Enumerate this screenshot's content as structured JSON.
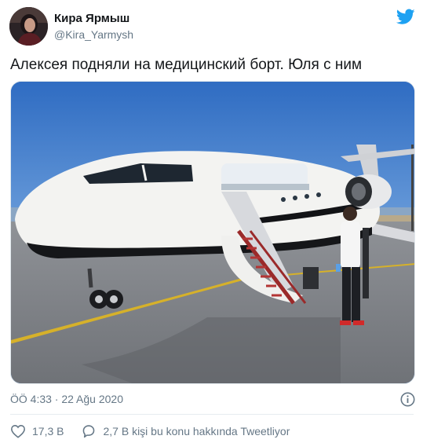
{
  "author": {
    "name": "Кира Ярмыш",
    "handle": "@Kira_Yarmysh"
  },
  "tweet": {
    "text": "Алексея подняли на медицинский борт. Юля с ним",
    "timestamp": "ÖÖ 4:33 · 22 Ağu 2020"
  },
  "actions": {
    "likes_count": "17,3 B",
    "conversation_label": "2,7 B kişi bu konu hakkında Tweetliyor"
  },
  "icons": {
    "brand": "twitter-bird-icon",
    "like": "heart-icon",
    "reply": "speech-bubble-icon",
    "info": "info-icon"
  },
  "colors": {
    "twitter_blue": "#1da1f2",
    "secondary_text": "#657786",
    "primary_text": "#14171a"
  }
}
